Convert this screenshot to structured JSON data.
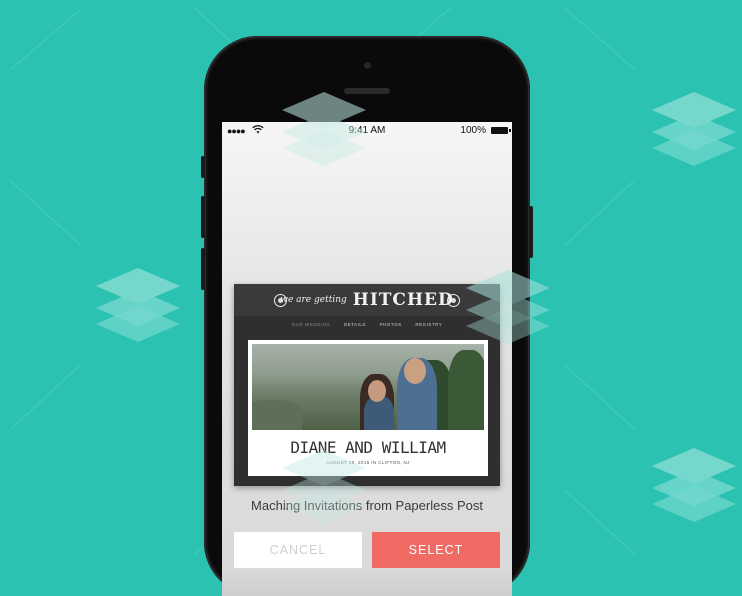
{
  "background": {
    "color": "#2bc2b2",
    "decoration": "stacked-layers-icon"
  },
  "status_bar": {
    "signal": "●●●●",
    "wifi": "wifi-icon",
    "time": "9:41 AM",
    "battery_percent": "100%"
  },
  "invitation": {
    "banner_small": "we are getting",
    "banner_big": "HITCHED",
    "nav": [
      "OUR WEDDING",
      "DETAILS",
      "PHOTOS",
      "REGISTRY"
    ],
    "names": "DIANE AND WILLIAM",
    "details": "AUGUST 26, 2015 IN CLIFTON, NJ"
  },
  "caption": "Maching Invitations from Paperless Post",
  "buttons": {
    "cancel": "CANCEL",
    "select": "SELECT"
  },
  "colors": {
    "accent": "#ef6b63",
    "teal": "#2bc2b2"
  }
}
